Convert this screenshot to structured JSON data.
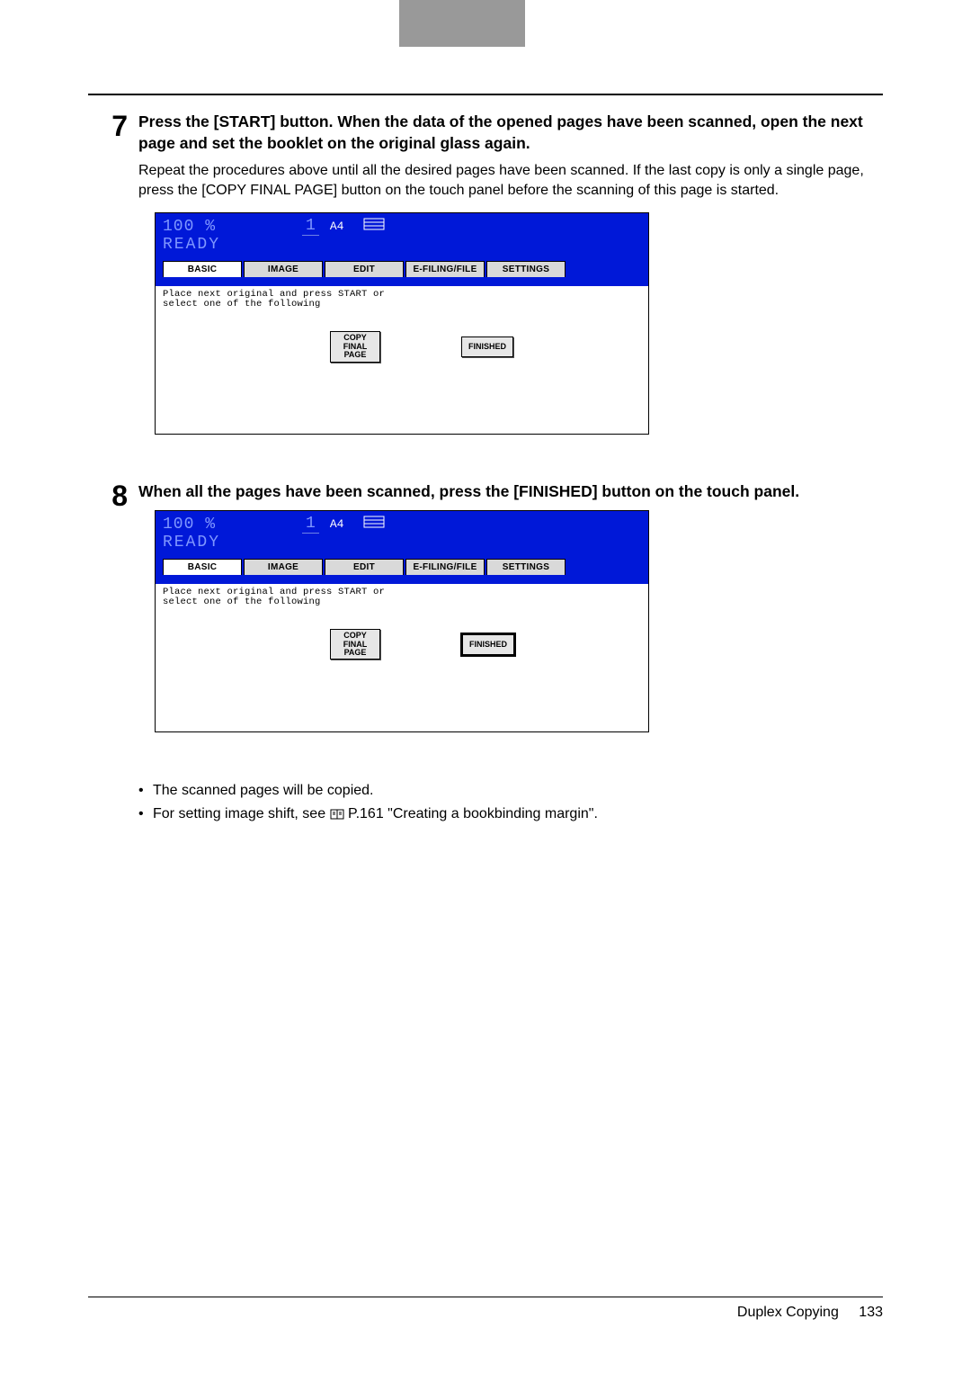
{
  "steps": [
    {
      "num": "7",
      "title": "Press the [START] button. When the data of the opened pages have been scanned, open the next page and set the booklet on the original glass again.",
      "para": "Repeat the procedures above until all the desired pages have been scanned. If the last copy is only a single page, press the [COPY FINAL PAGE] button on the touch panel before the scanning of this page is started."
    },
    {
      "num": "8",
      "title": "When all the pages have been scanned, press the [FINISHED] button on the touch panel.",
      "para": ""
    }
  ],
  "bullets": [
    "The scanned pages will be copied.",
    "For setting image shift, see      P.161 \"Creating a bookbinding margin\"."
  ],
  "panel": {
    "zoom": "100 %",
    "count": "1",
    "paper": "A4",
    "ready": "READY",
    "tabs": [
      "BASIC",
      "IMAGE",
      "EDIT",
      "E-FILING/FILE",
      "SETTINGS"
    ],
    "msg_line1": "Place next original and press START or",
    "msg_line2": "select one of the following",
    "btn_copy": "COPY\nFINAL\nPAGE",
    "btn_finished": "FINISHED"
  },
  "footer": {
    "title": "Duplex Copying",
    "page": "133"
  }
}
